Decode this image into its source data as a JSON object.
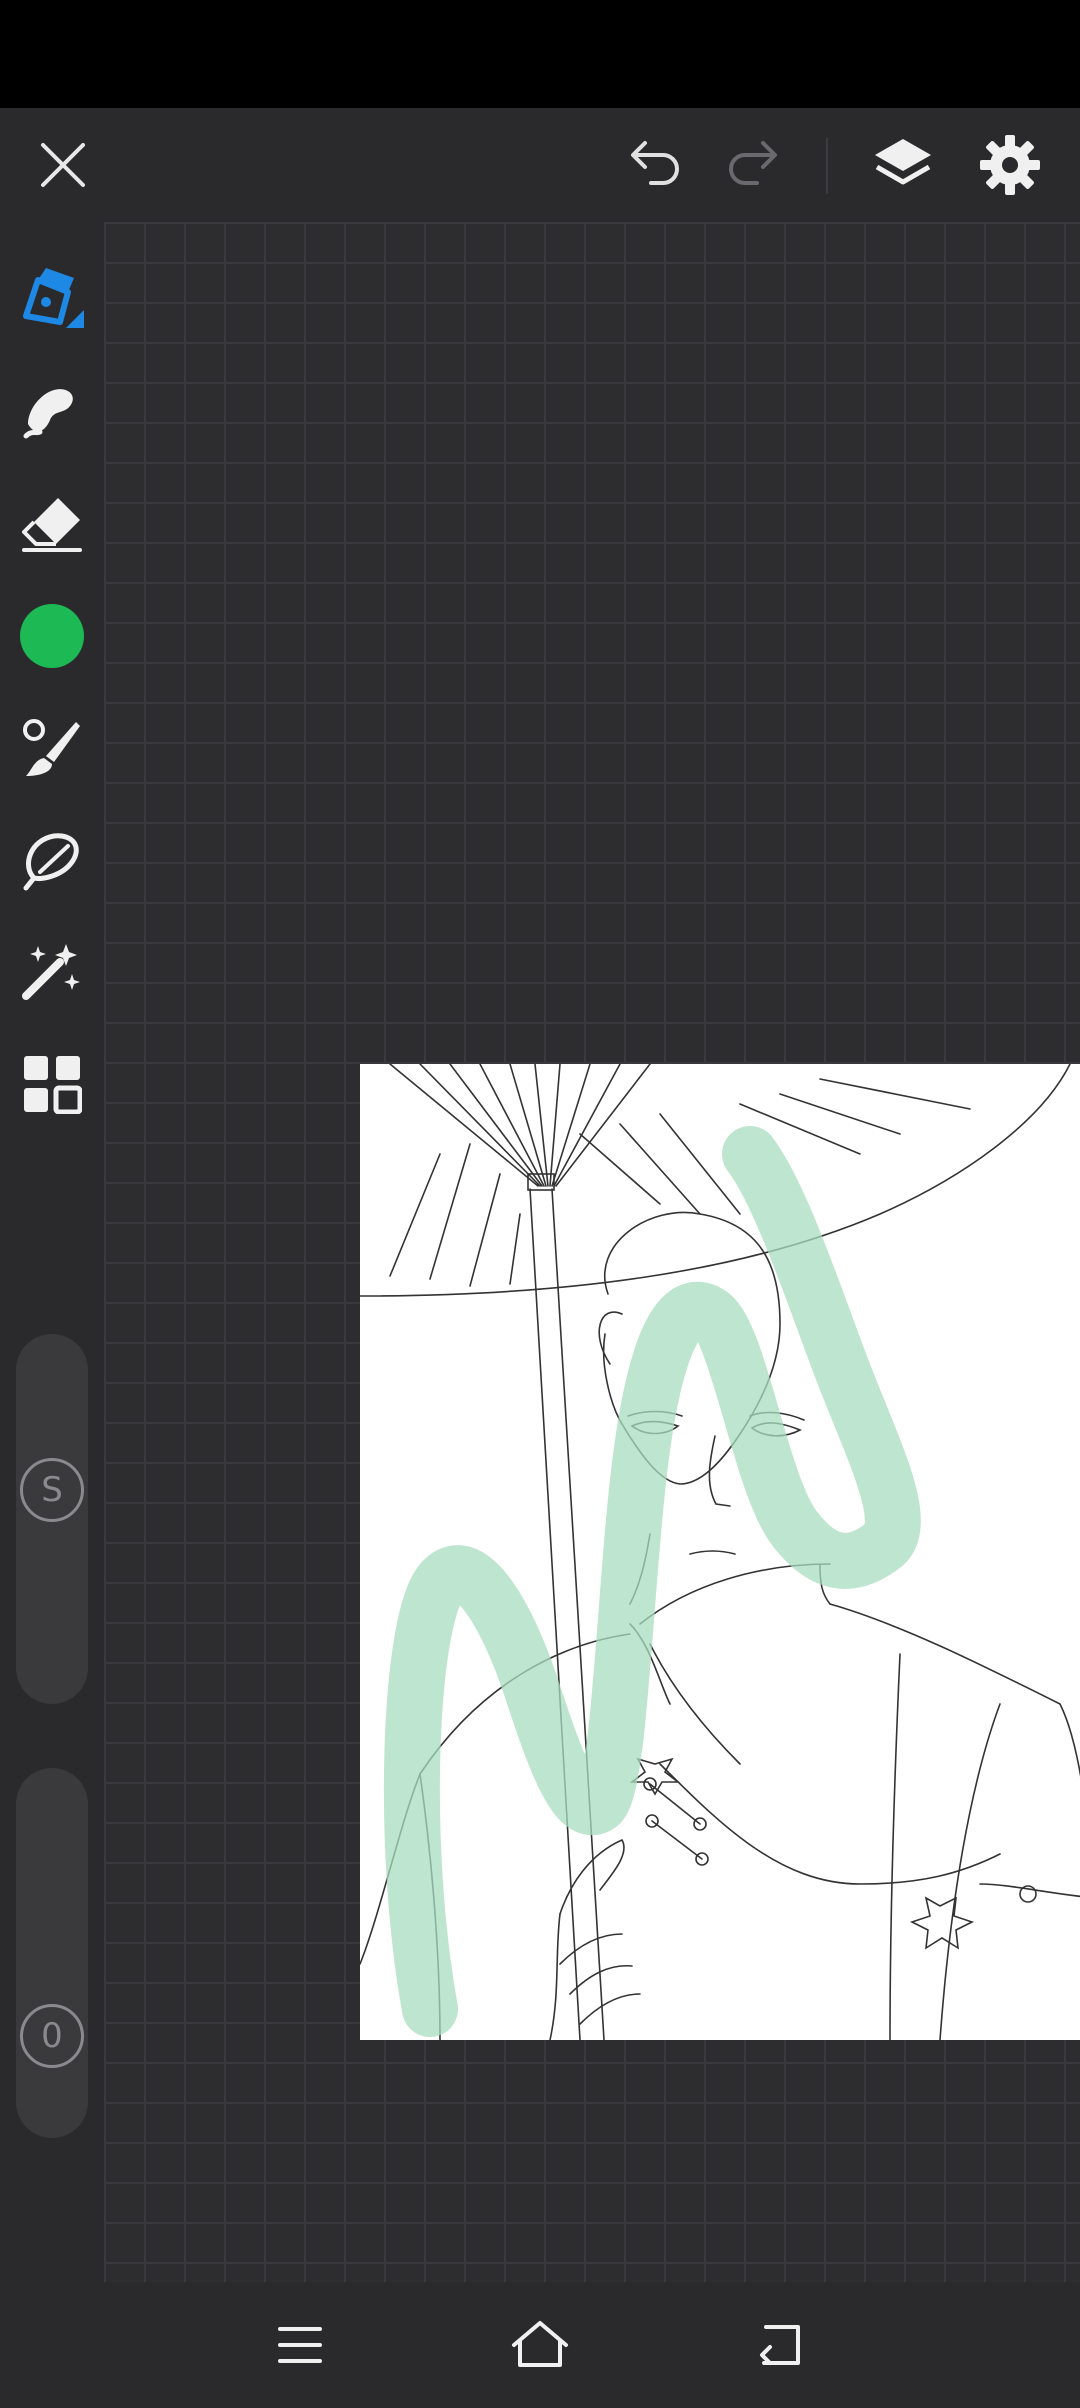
{
  "app": {
    "name": "drawing-canvas"
  },
  "top_bar": {
    "close": "close-icon",
    "undo": "undo-icon",
    "redo": "redo-icon",
    "layers": "layers-icon",
    "settings": "gear-icon"
  },
  "tools": [
    {
      "name": "pen",
      "icon": "pen-icon",
      "active": true
    },
    {
      "name": "smudge",
      "icon": "smudge-icon"
    },
    {
      "name": "eraser",
      "icon": "eraser-icon"
    },
    {
      "name": "color",
      "icon": "color-swatch",
      "color": "#1db954"
    },
    {
      "name": "brush",
      "icon": "brush-icon"
    },
    {
      "name": "lasso",
      "icon": "lasso-icon"
    },
    {
      "name": "magic",
      "icon": "magic-wand-icon"
    },
    {
      "name": "more",
      "icon": "grid-icon"
    }
  ],
  "sliders": {
    "size_label": "S",
    "opacity_label": "0"
  },
  "colors": {
    "accent": "#1e88e5",
    "brush": "#1db954",
    "stroke": "#c7e8d7"
  },
  "nav": {
    "menu": "menu-icon",
    "home": "home-icon",
    "back": "back-icon"
  }
}
